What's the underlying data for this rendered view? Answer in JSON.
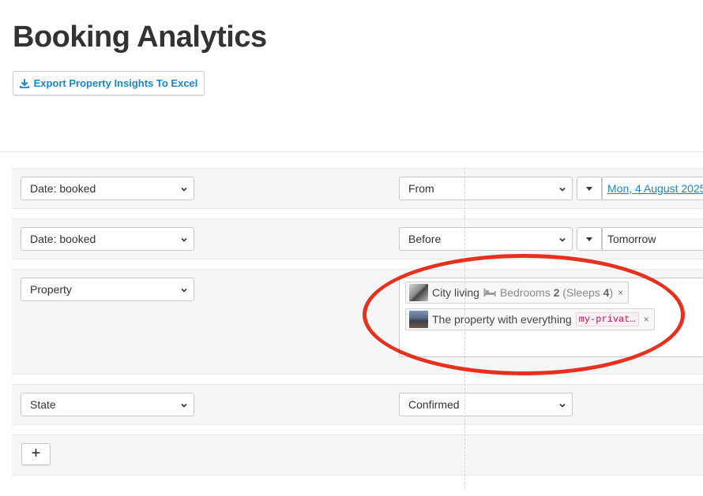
{
  "page": {
    "title": "Booking Analytics"
  },
  "toolbar": {
    "export_label": "Export Property Insights To Excel"
  },
  "filters": [
    {
      "field": "Date: booked",
      "operator": "From",
      "value": "Mon, 4 August 2025"
    },
    {
      "field": "Date: booked",
      "operator": "Before",
      "value": "Tomorrow"
    },
    {
      "field": "Property",
      "chips": [
        {
          "name": "City living",
          "details_prefix": "Bedrooms",
          "bedrooms": "2",
          "sleeps_prefix": "(Sleeps",
          "sleeps": "4",
          "sleeps_suffix": ")",
          "remove": "×"
        },
        {
          "name": "The property with everything",
          "tag": "my-privat…",
          "remove": "×"
        }
      ]
    },
    {
      "field": "State",
      "operator": "Confirmed"
    }
  ],
  "add_button": {
    "label": "+"
  },
  "colors": {
    "accent": "#1a86c8",
    "annotation": "#e8301f",
    "tag_text": "#c2185b"
  },
  "icons": [
    "download-icon",
    "chevron-down-icon",
    "caret-down-icon",
    "bed-icon",
    "close-icon",
    "plus-icon"
  ]
}
